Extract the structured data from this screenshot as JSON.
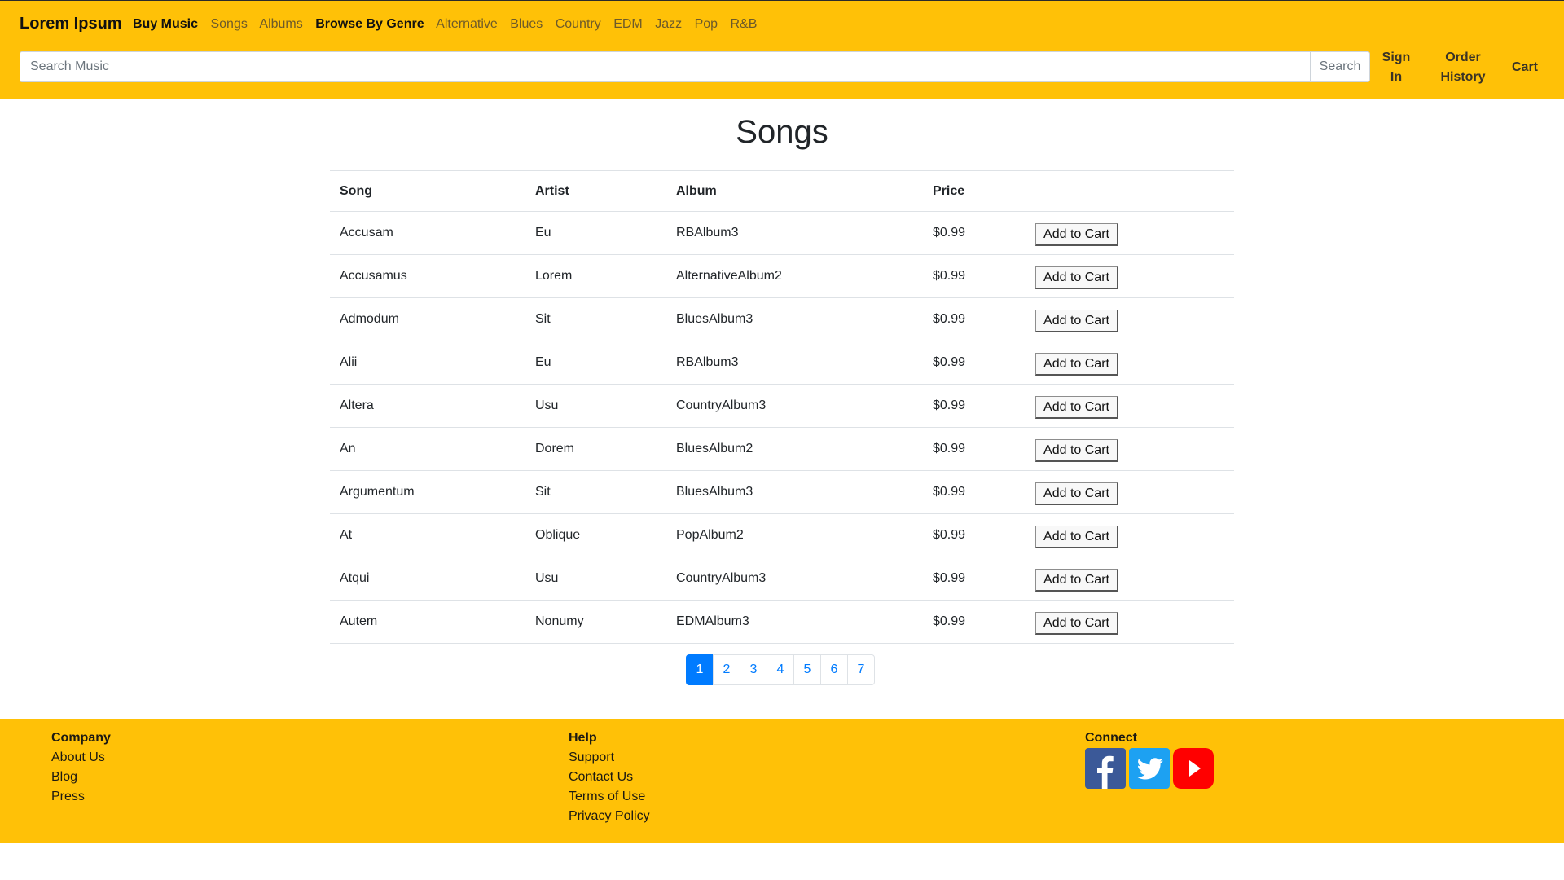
{
  "header": {
    "brand": "Lorem Ipsum",
    "nav": [
      {
        "label": "Buy Music",
        "strong": true
      },
      {
        "label": "Songs",
        "strong": false
      },
      {
        "label": "Albums",
        "strong": false
      },
      {
        "label": "Browse By Genre",
        "strong": true
      },
      {
        "label": "Alternative",
        "strong": false
      },
      {
        "label": "Blues",
        "strong": false
      },
      {
        "label": "Country",
        "strong": false
      },
      {
        "label": "EDM",
        "strong": false
      },
      {
        "label": "Jazz",
        "strong": false
      },
      {
        "label": "Pop",
        "strong": false
      },
      {
        "label": "R&B",
        "strong": false
      }
    ],
    "search": {
      "placeholder": "Search Music",
      "value": "",
      "button_label": "Search"
    },
    "sign_in": [
      "Sign",
      "In"
    ],
    "order_history": [
      "Order",
      "History"
    ],
    "cart": "Cart"
  },
  "main": {
    "title": "Songs",
    "columns": [
      "Song",
      "Artist",
      "Album",
      "Price"
    ],
    "add_to_cart_label": "Add to Cart",
    "rows": [
      {
        "song": "Accusam",
        "artist": "Eu",
        "album": "RBAlbum3",
        "price": "$0.99"
      },
      {
        "song": "Accusamus",
        "artist": "Lorem",
        "album": "AlternativeAlbum2",
        "price": "$0.99"
      },
      {
        "song": "Admodum",
        "artist": "Sit",
        "album": "BluesAlbum3",
        "price": "$0.99"
      },
      {
        "song": "Alii",
        "artist": "Eu",
        "album": "RBAlbum3",
        "price": "$0.99"
      },
      {
        "song": "Altera",
        "artist": "Usu",
        "album": "CountryAlbum3",
        "price": "$0.99"
      },
      {
        "song": "An",
        "artist": "Dorem",
        "album": "BluesAlbum2",
        "price": "$0.99"
      },
      {
        "song": "Argumentum",
        "artist": "Sit",
        "album": "BluesAlbum3",
        "price": "$0.99"
      },
      {
        "song": "At",
        "artist": "Oblique",
        "album": "PopAlbum2",
        "price": "$0.99"
      },
      {
        "song": "Atqui",
        "artist": "Usu",
        "album": "CountryAlbum3",
        "price": "$0.99"
      },
      {
        "song": "Autem",
        "artist": "Nonumy",
        "album": "EDMAlbum3",
        "price": "$0.99"
      }
    ],
    "pagination": {
      "pages": [
        "1",
        "2",
        "3",
        "4",
        "5",
        "6",
        "7"
      ],
      "current": "1"
    }
  },
  "footer": {
    "company": {
      "heading": "Company",
      "links": [
        "About Us",
        "Blog",
        "Press"
      ]
    },
    "help": {
      "heading": "Help",
      "links": [
        "Support",
        "Contact Us",
        "Terms of Use",
        "Privacy Policy"
      ]
    },
    "connect": {
      "heading": "Connect",
      "icons": [
        "facebook-icon",
        "twitter-icon",
        "youtube-icon"
      ]
    }
  },
  "colors": {
    "header_bg": "#ffc107",
    "footer_bg": "#ffc107",
    "accent": "#007bff",
    "facebook": "#3b5998",
    "twitter": "#1da1f2",
    "youtube": "#ff0000"
  }
}
